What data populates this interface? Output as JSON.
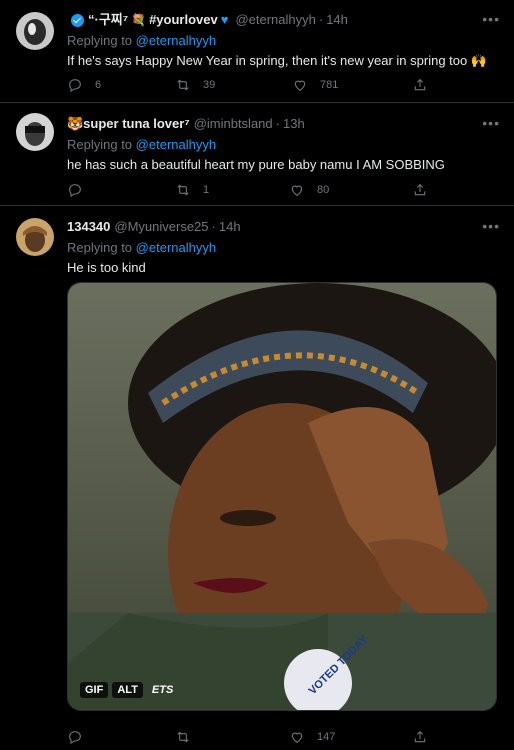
{
  "tweets": [
    {
      "display_name": "“·구찌⁷",
      "display_name_extra": "#yourlovev",
      "flower_emoji": "💐",
      "handle": "@eternalhyyh",
      "time": "14h",
      "reply_prefix": "Replying to",
      "reply_to": "@eternalhyyh",
      "text": "If he's says Happy New Year in spring, then it's new year in spring too 🙌",
      "reply_count": "6",
      "retweet_count": "39",
      "like_count": "781"
    },
    {
      "display_name": "🐯super tuna lover⁷",
      "handle": "@iminbtsland",
      "time": "13h",
      "reply_prefix": "Replying to",
      "reply_to": "@eternalhyyh",
      "text": "he has such a beautiful heart my pure baby namu I AM SOBBING",
      "reply_count": "",
      "retweet_count": "1",
      "like_count": "80"
    },
    {
      "display_name": "134340",
      "handle": "@Myuniverse25",
      "time": "14h",
      "reply_prefix": "Replying to",
      "reply_to": "@eternalhyyh",
      "text": "He is too kind",
      "reply_count": "",
      "retweet_count": "",
      "like_count": "147",
      "media": {
        "gif_label": "GIF",
        "alt_label": "ALT",
        "watermark": "ETS",
        "sticker_text": "VOTED TODAY"
      }
    }
  ],
  "colors": {
    "background": "#000000",
    "accent": "#1d9bf0",
    "muted": "#71767b",
    "text": "#e7e9ea",
    "divider": "#2f3336"
  },
  "icons": [
    "more-icon",
    "reply-icon",
    "retweet-icon",
    "like-icon",
    "share-icon",
    "verified-icon"
  ]
}
